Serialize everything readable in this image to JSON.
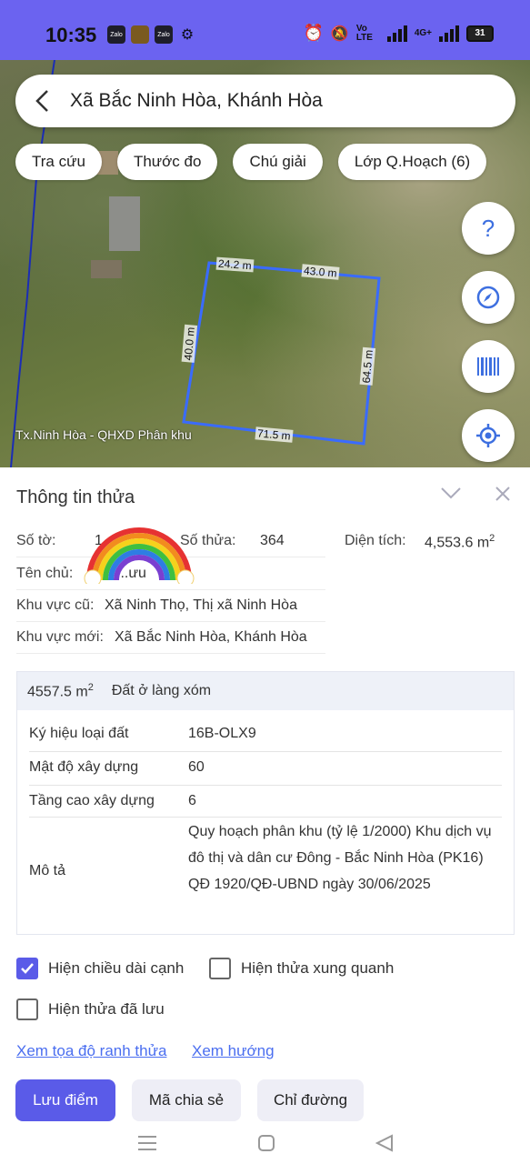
{
  "status_bar": {
    "time": "10:35",
    "app_icons": [
      "Zalo",
      "game",
      "Zalo",
      "gear"
    ],
    "network": "Vo LTE",
    "signal": "4G+",
    "battery": "31"
  },
  "search": {
    "title": "Xã Bắc Ninh Hòa, Khánh Hòa"
  },
  "chips": [
    "Tra cứu",
    "Thước đo",
    "Chú giải",
    "Lớp Q.Hoạch (6)"
  ],
  "fabs": [
    "help-icon",
    "compass-icon",
    "barcode-icon",
    "locate-icon"
  ],
  "map": {
    "edges": [
      "24.2 m",
      "43.0 m",
      "40.0 m",
      "64.5 m",
      "71.5 m"
    ],
    "watermark": "Tx.Ninh Hòa - QHXD Phân khu",
    "boundary_color": "#3a6bff"
  },
  "panel": {
    "heading": "Thông tin thửa",
    "so_to_label": "Số tờ:",
    "so_to_value": "1",
    "so_thua_label": "Số thửa:",
    "so_thua_value": "364",
    "dien_tich_label": "Diện tích:",
    "dien_tich_value": "4,553.6 m",
    "dien_tich_unit_sup": "2",
    "ten_chu_label": "Tên chủ:",
    "ten_chu_value": "...ưu",
    "khu_vuc_cu_label": "Khu vực cũ:",
    "khu_vuc_cu_value": "Xã Ninh Thọ, Thị xã Ninh Hòa",
    "khu_vuc_moi_label": "Khu vực mới:",
    "khu_vuc_moi_value": "Xã Bắc Ninh Hòa, Khánh Hòa"
  },
  "detail": {
    "area": "4557.5 m",
    "area_sup": "2",
    "land_type": "Đất ở làng xóm",
    "rows": [
      {
        "label": "Ký hiệu loại đất",
        "value": "16B-OLX9"
      },
      {
        "label": "Mật độ xây dựng",
        "value": "60"
      },
      {
        "label": "Tầng cao xây dựng",
        "value": "6"
      },
      {
        "label": "Mô tả",
        "value": "Quy hoạch phân khu (tỷ lệ 1/2000) Khu dịch vụ đô thị và dân cư Đông - Bắc Ninh Hòa (PK16) QĐ 1920/QĐ-UBND ngày 30/06/2025"
      }
    ]
  },
  "options": {
    "show_edge_length": {
      "label": "Hiện chiều dài cạnh",
      "checked": true
    },
    "show_neighbors": {
      "label": "Hiện thửa xung quanh",
      "checked": false
    },
    "show_saved": {
      "label": "Hiện thửa đã lưu",
      "checked": false
    }
  },
  "links": {
    "coords": "Xem tọa độ ranh thửa",
    "direction": "Xem hướng"
  },
  "buttons": {
    "save": "Lưu điểm",
    "share": "Mã chia sẻ",
    "directions": "Chỉ đường"
  },
  "colors": {
    "accent": "#5a5be8",
    "status_bar": "#6b63f0",
    "link": "#4a6ef0"
  }
}
